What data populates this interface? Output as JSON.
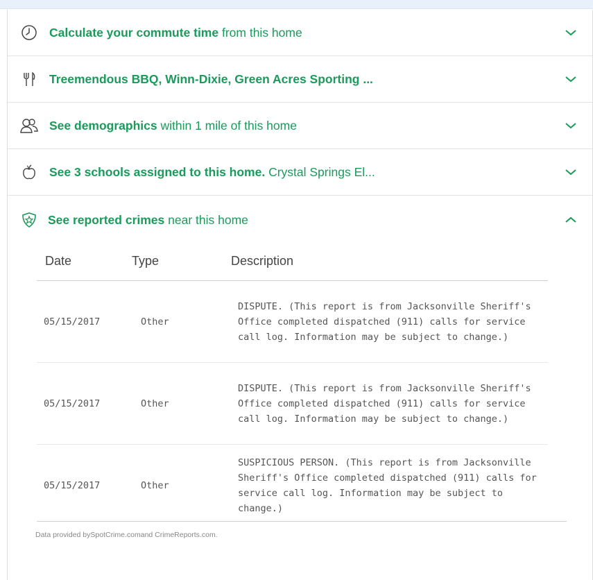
{
  "rows": [
    {
      "icon": "clock-icon",
      "bold": "Calculate your commute time",
      "rest": " from this home"
    },
    {
      "icon": "fork-knife-icon",
      "bold": "Treemendous BBQ, Winn-Dixie, Green Acres Sporting ...",
      "rest": ""
    },
    {
      "icon": "people-icon",
      "bold": "See demographics",
      "rest": " within 1 mile of this home"
    },
    {
      "icon": "apple-icon",
      "bold": "See 3 schools assigned to this home.",
      "rest": " Crystal Springs El..."
    }
  ],
  "crimes": {
    "icon": "shield-star-icon",
    "bold": "See reported crimes",
    "rest": " near this home",
    "columns": {
      "date": "Date",
      "type": "Type",
      "description": "Description"
    },
    "rows": [
      {
        "date": "05/15/2017",
        "type": "Other",
        "description": "DISPUTE. (This report is from Jacksonville Sheriff's Office completed dispatched (911) calls for service call log. Information may be subject to change.)"
      },
      {
        "date": "05/15/2017",
        "type": "Other",
        "description": "DISPUTE. (This report is from Jacksonville Sheriff's Office completed dispatched (911) calls for service call log. Information may be subject to change.)"
      },
      {
        "date": "05/15/2017",
        "type": "Other",
        "description": "SUSPICIOUS PERSON. (This report is from Jacksonville Sheriff's Office completed dispatched (911) calls for service call log. Information may be subject to change.)"
      }
    ],
    "footnote": "Data provided bySpotCrime.comand CrimeReports.com."
  },
  "colors": {
    "accent": "#1a9b5c",
    "icon": "#444444",
    "chevron": "#1a9b5c"
  }
}
